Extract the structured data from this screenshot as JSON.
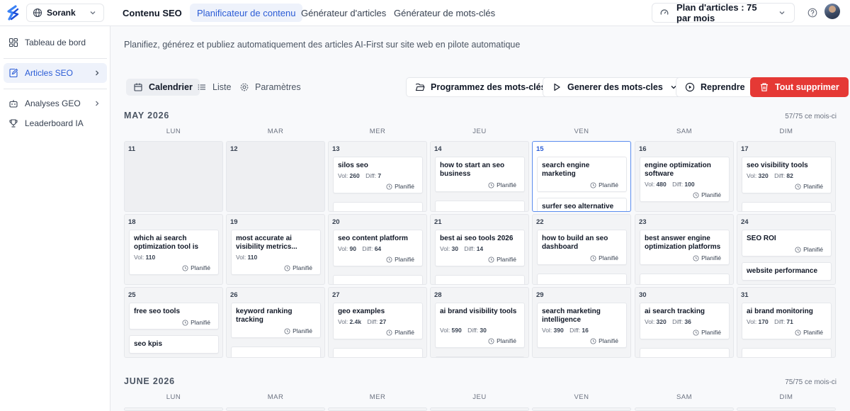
{
  "topbar": {
    "workspace": "Sorank",
    "brand": "Contenu SEO",
    "tabs": [
      "Planificateur de contenu",
      "Générateur d'articles",
      "Générateur de mots-clés"
    ],
    "plan": "Plan d'articles : 75 par mois"
  },
  "sidebar": {
    "items": [
      "Tableau de bord",
      "Articles SEO",
      "Analyses GEO",
      "Leaderboard IA"
    ]
  },
  "main": {
    "subtitle": "Planifiez, générez et publiez automatiquement des articles AI-First sur site web en pilote automatique",
    "views": [
      "Calendrier",
      "Liste",
      "Paramètres"
    ],
    "actions": {
      "program": "Programmez des mots-clés",
      "generate": "Generer des mots-cles",
      "resume": "Reprendre",
      "delete_all": "Tout supprimer"
    }
  },
  "weekdays": [
    "LUN",
    "MAR",
    "MER",
    "JEU",
    "VEN",
    "SAM",
    "DIM"
  ],
  "status_label": "Planifié",
  "months": [
    {
      "title": "MAY 2026",
      "count": "57/75 ce mois-ci",
      "weeks": [
        [
          {
            "day": "11",
            "cards": []
          },
          {
            "day": "12",
            "cards": []
          },
          {
            "day": "13",
            "cards": [
              {
                "title": "silos seo",
                "vol": "260",
                "diff": "7"
              },
              {
                "title": "",
                "stub": true
              }
            ]
          },
          {
            "day": "14",
            "cards": [
              {
                "title": "how to start an seo business"
              },
              {
                "title": "",
                "stub": true
              }
            ]
          },
          {
            "day": "15",
            "today": true,
            "cards": [
              {
                "title": "search engine marketing"
              },
              {
                "title": "surfer seo alternative",
                "nostatus": true
              }
            ]
          },
          {
            "day": "16",
            "cards": [
              {
                "title": "engine optimization software",
                "vol": "480",
                "diff": "100"
              }
            ]
          },
          {
            "day": "17",
            "cards": [
              {
                "title": "seo visibility tools",
                "vol": "320",
                "diff": "82"
              },
              {
                "title": "",
                "stub": true
              }
            ]
          }
        ],
        [
          {
            "day": "18",
            "cards": [
              {
                "title": "which ai search optimization tool is mo...",
                "vol": "110"
              }
            ]
          },
          {
            "day": "19",
            "cards": [
              {
                "title": "most accurate ai visibility metrics...",
                "vol": "110"
              }
            ]
          },
          {
            "day": "20",
            "cards": [
              {
                "title": "seo content platform",
                "vol": "90",
                "diff": "64"
              },
              {
                "title": "",
                "stub": true
              }
            ]
          },
          {
            "day": "21",
            "cards": [
              {
                "title": "best ai seo tools 2026",
                "vol": "30",
                "diff": "14"
              },
              {
                "title": "",
                "stub": true
              }
            ]
          },
          {
            "day": "22",
            "cards": [
              {
                "title": "how to build an seo dashboard"
              },
              {
                "title": "",
                "stub": true
              }
            ]
          },
          {
            "day": "23",
            "cards": [
              {
                "title": "best answer engine optimization platforms"
              },
              {
                "title": "",
                "stub": true
              }
            ]
          },
          {
            "day": "24",
            "cards": [
              {
                "title": "SEO ROI"
              },
              {
                "title": "website performance",
                "nostatus": true
              }
            ]
          }
        ],
        [
          {
            "day": "25",
            "cards": [
              {
                "title": "free seo tools"
              },
              {
                "title": "seo kpis",
                "nostatus": true
              }
            ]
          },
          {
            "day": "26",
            "cards": [
              {
                "title": "keyword ranking tracking"
              },
              {
                "title": "",
                "stub": true
              }
            ]
          },
          {
            "day": "27",
            "cards": [
              {
                "title": "geo examples",
                "vol": "2.4k",
                "diff": "27"
              },
              {
                "title": "",
                "stub": true
              }
            ]
          },
          {
            "day": "28",
            "cards": [
              {
                "title": "ai brand visibility tools",
                "vol": "590",
                "diff": "30"
              },
              {
                "title": "",
                "stub": true
              }
            ]
          },
          {
            "day": "29",
            "cards": [
              {
                "title": "search marketing intelligence",
                "vol": "390",
                "diff": "16"
              }
            ]
          },
          {
            "day": "30",
            "cards": [
              {
                "title": "ai search tracking",
                "vol": "320",
                "diff": "36"
              },
              {
                "title": "",
                "stub": true
              }
            ]
          },
          {
            "day": "31",
            "cards": [
              {
                "title": "ai brand monitoring",
                "vol": "170",
                "diff": "71"
              },
              {
                "title": "",
                "stub": true
              }
            ]
          }
        ]
      ]
    },
    {
      "title": "JUNE 2026",
      "count": "75/75 ce mois-ci",
      "weeks": []
    }
  ],
  "colors": {
    "accent": "#2b5cd6",
    "danger": "#e53935",
    "accent_bg": "#eef2fb"
  }
}
